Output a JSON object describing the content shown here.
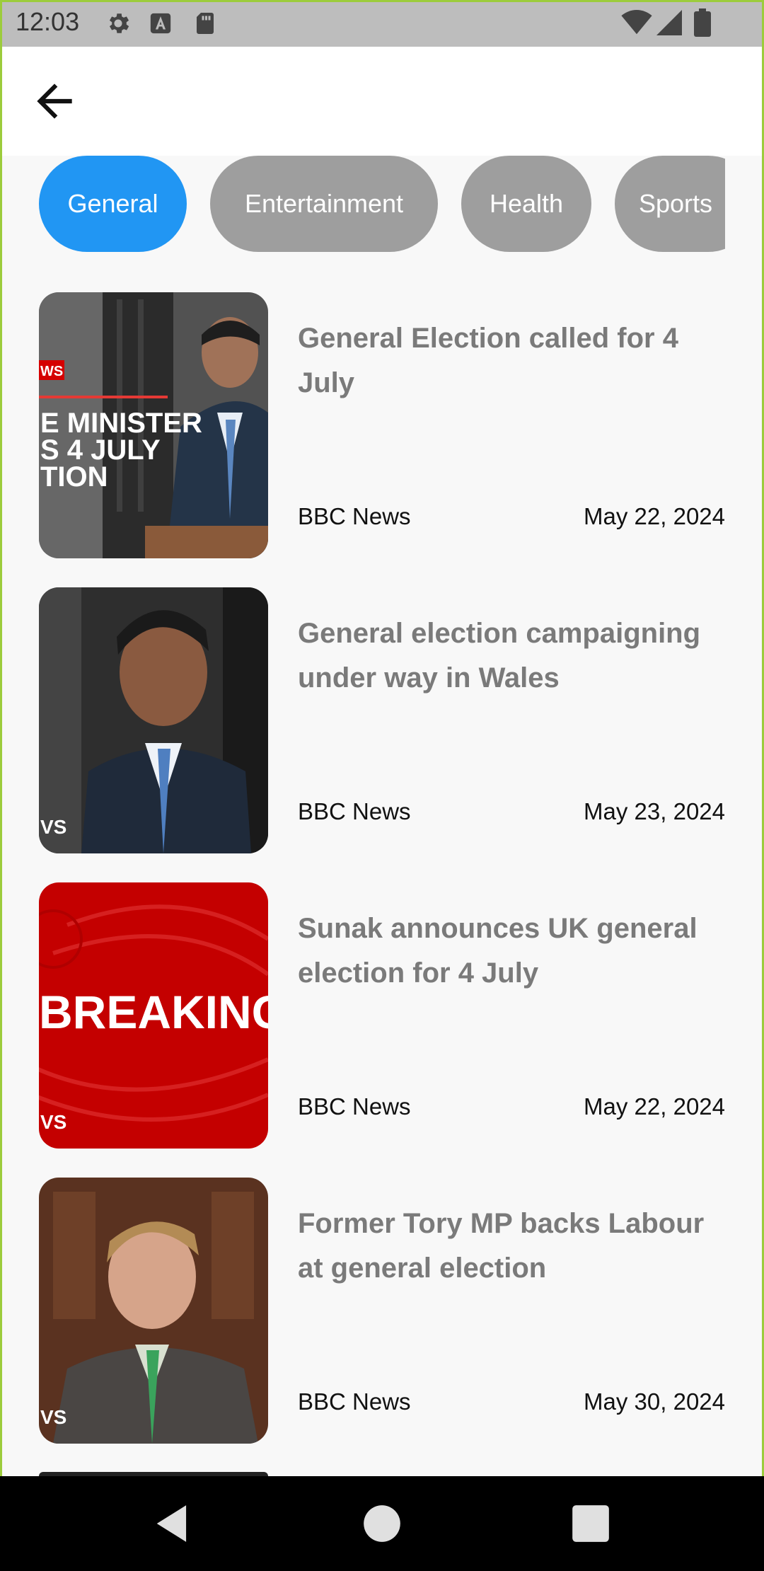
{
  "status_bar": {
    "time": "12:03",
    "left_icons": [
      "gear-icon",
      "a-badge-icon",
      "sd-card-icon"
    ],
    "right_icons": [
      "wifi-icon",
      "signal-icon",
      "battery-icon"
    ]
  },
  "app_bar": {
    "back_icon": "arrow-left-icon"
  },
  "categories": {
    "selected": "General",
    "items": [
      {
        "label": "General"
      },
      {
        "label": "Entertainment"
      },
      {
        "label": "Health"
      },
      {
        "label": "Sports"
      }
    ]
  },
  "articles": [
    {
      "title": "General Election called for 4 July",
      "source": "BBC News",
      "date": "May 22, 2024",
      "thumb_overlay": [
        "WS",
        "E MINISTER",
        "S 4 JULY",
        "TION"
      ]
    },
    {
      "title": "General election campaigning under way in Wales",
      "source": "BBC News",
      "date": "May 23, 2024",
      "thumb_overlay": [
        "VS"
      ]
    },
    {
      "title": "Sunak announces UK general election for 4 July",
      "source": "BBC News",
      "date": "May 22, 2024",
      "thumb_overlay": [
        "BREAKING",
        "VS"
      ]
    },
    {
      "title": "Former Tory MP backs Labour at general election",
      "source": "BBC News",
      "date": "May 30, 2024",
      "thumb_overlay": [
        "VS"
      ]
    }
  ],
  "nav_bar": {
    "icons": [
      "back-triangle-icon",
      "home-circle-icon",
      "recents-square-icon"
    ]
  },
  "colors": {
    "chip_active": "#2196f3",
    "chip_inactive": "#9e9e9e",
    "title_text": "#7a7a7a",
    "status_bar": "#bdbdbd",
    "accent_border": "#9ccc3c"
  }
}
